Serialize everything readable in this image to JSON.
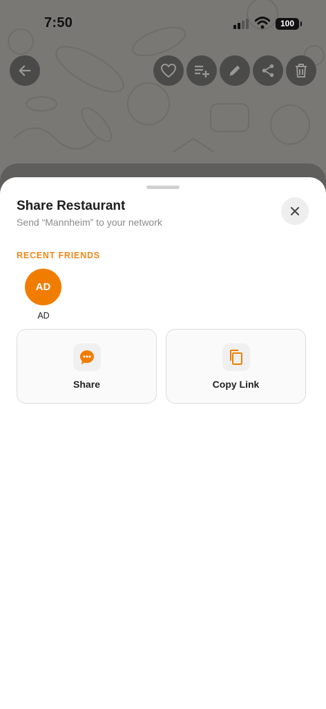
{
  "status_bar": {
    "time": "7:50",
    "battery": "100"
  },
  "toolbar": {
    "icons": [
      "back-arrow-icon",
      "heart-icon",
      "playlist-add-icon",
      "edit-pencil-icon",
      "share-icon",
      "trash-icon"
    ]
  },
  "sheet": {
    "title": "Share Restaurant",
    "subtitle": "Send “Mannheim” to your network",
    "section_label": "RECENT FRIENDS",
    "friends": [
      {
        "initials": "AD",
        "name": "AD"
      }
    ],
    "actions": [
      {
        "label": "Share",
        "icon": "chat-bubble-icon"
      },
      {
        "label": "Copy Link",
        "icon": "copy-icon"
      }
    ]
  },
  "colors": {
    "accent": "#f07d00",
    "section_label": "#f08519",
    "backdrop": "#7a7874",
    "toolbar_button": "#4a4a48"
  }
}
